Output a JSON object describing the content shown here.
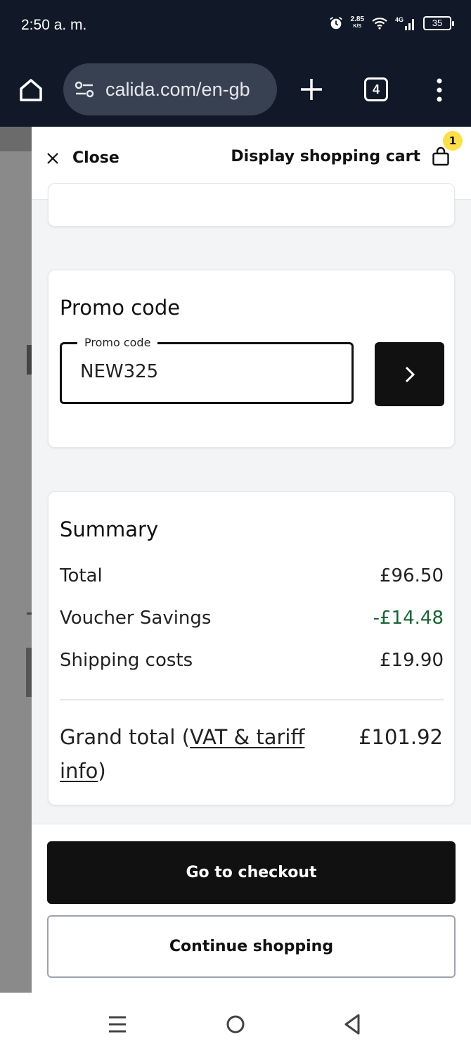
{
  "status_bar": {
    "time": "2:50 a. m.",
    "net_speed": "2.85",
    "net_speed_unit": "K/S",
    "network_type": "4G",
    "battery": "35",
    "icons": [
      "alarm-icon",
      "wifi-icon",
      "signal-icon",
      "battery-icon"
    ]
  },
  "browser": {
    "url": "calida.com/en-gb",
    "tab_count": "4",
    "icons": [
      "home-icon",
      "tune-icon",
      "new-tab-icon",
      "more-menu-icon"
    ]
  },
  "drawer": {
    "close_label": "Close",
    "cart_label": "Display shopping cart",
    "cart_count": "1"
  },
  "promo": {
    "title": "Promo code",
    "field_label": "Promo code",
    "value": "NEW325"
  },
  "summary": {
    "title": "Summary",
    "total_label": "Total",
    "total_value": "£96.50",
    "voucher_label": "Voucher Savings",
    "voucher_value": "-£14.48",
    "shipping_label": "Shipping costs",
    "shipping_value": "£19.90",
    "grand_label_prefix": "Grand total (",
    "grand_link": "VAT & tariff info",
    "grand_label_suffix": ")",
    "grand_value": "£101.92"
  },
  "actions": {
    "checkout": "Go to checkout",
    "continue": "Continue shopping"
  },
  "colors": {
    "chrome_bg": "#111827",
    "accent_badge": "#fde047",
    "savings_green": "#166534",
    "primary_button": "#111111"
  }
}
